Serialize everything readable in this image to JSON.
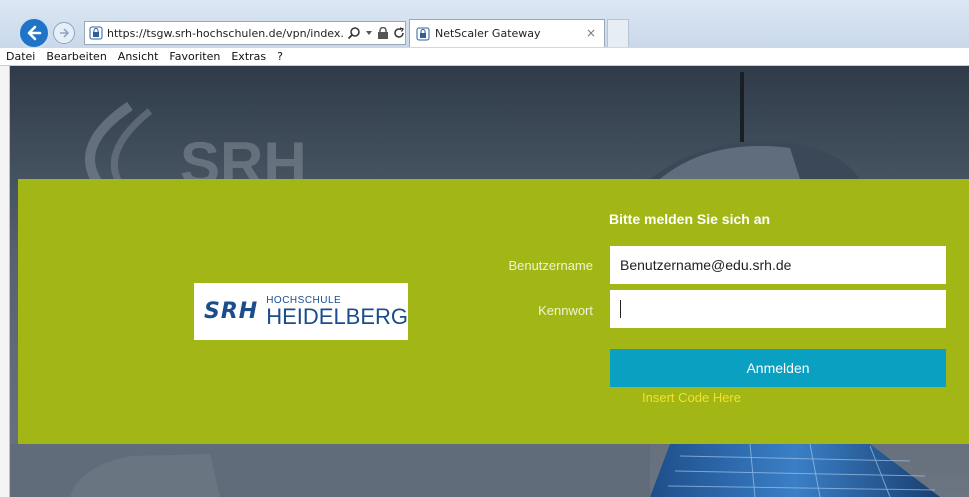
{
  "browser": {
    "url": "https://tsgw.srh-hochschulen.de/vpn/index.h",
    "tab_title": "NetScaler Gateway",
    "tab_close": "×",
    "menu": [
      "Datei",
      "Bearbeiten",
      "Ansicht",
      "Favoriten",
      "Extras",
      "?"
    ]
  },
  "logo": {
    "brand": "SRH",
    "top_line": "HOCHSCHULE",
    "bottom_line": "HEIDELBERG"
  },
  "login": {
    "title": "Bitte melden Sie sich an",
    "username_label": "Benutzername",
    "username_value": "Benutzername@edu.srh.de",
    "password_label": "Kennwort",
    "password_value": "",
    "submit_label": "Anmelden",
    "insert_code": "Insert Code Here"
  },
  "colors": {
    "band": "#a2b716",
    "button": "#0aa0c1",
    "insert_code": "#f2e12b",
    "logo_blue": "#1b4d8c"
  }
}
